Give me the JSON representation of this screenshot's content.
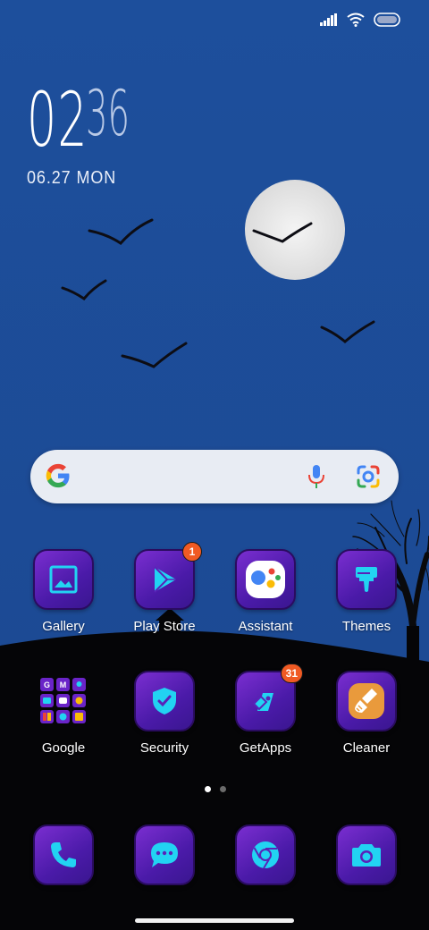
{
  "status_bar": {
    "signal_icon": "signal-icon",
    "wifi_icon": "wifi-icon",
    "battery_icon": "battery-icon"
  },
  "clock": {
    "hours": "02",
    "minutes": "36",
    "date": "06.27 MON"
  },
  "search": {
    "google_icon": "google-g-icon",
    "mic_icon": "microphone-icon",
    "lens_icon": "google-lens-icon"
  },
  "apps_row1": [
    {
      "label": "Gallery",
      "icon": "gallery-icon"
    },
    {
      "label": "Play Store",
      "icon": "play-store-icon",
      "badge": "1"
    },
    {
      "label": "Assistant",
      "icon": "assistant-icon"
    },
    {
      "label": "Themes",
      "icon": "paint-brush-icon"
    }
  ],
  "apps_row2": [
    {
      "label": "Google",
      "icon": "google-folder-icon"
    },
    {
      "label": "Security",
      "icon": "shield-icon"
    },
    {
      "label": "GetApps",
      "icon": "getapps-icon",
      "badge": "31"
    },
    {
      "label": "Cleaner",
      "icon": "broom-icon"
    }
  ],
  "dock": [
    {
      "icon": "phone-icon"
    },
    {
      "icon": "messages-icon"
    },
    {
      "icon": "chrome-icon"
    },
    {
      "icon": "camera-icon"
    }
  ],
  "page_indicator": {
    "pages": 2,
    "current": 1
  },
  "colors": {
    "sky": "#1e4f9a",
    "tile_gradient_start": "#7a2ed0",
    "tile_gradient_end": "#3a1690",
    "badge": "#f05a23",
    "icon_accent": "#22d3f2"
  }
}
